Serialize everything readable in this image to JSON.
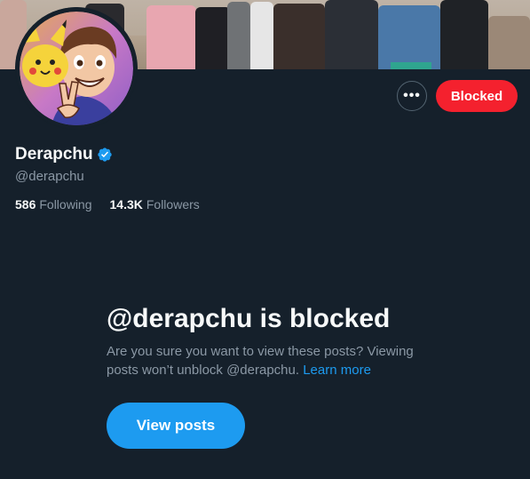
{
  "profile": {
    "display_name": "Derapchu",
    "handle": "@derapchu",
    "verified": true,
    "following_count": "586",
    "following_label": "Following",
    "followers_count": "14.3K",
    "followers_label": "Followers"
  },
  "actions": {
    "more_label": "•••",
    "blocked_label": "Blocked"
  },
  "blocked_notice": {
    "title": "@derapchu is blocked",
    "description": "Are you sure you want to view these posts? Viewing posts won’t unblock @derapchu.",
    "learn_more": "Learn more",
    "view_posts_label": "View posts"
  },
  "colors": {
    "background": "#15202b",
    "text_primary": "#f7f9f9",
    "text_secondary": "#8b98a5",
    "accent_blue": "#1d9bf0",
    "blocked_red": "#f4212e"
  },
  "icons": {
    "verified": "verified-badge-icon",
    "more": "more-options-icon"
  }
}
